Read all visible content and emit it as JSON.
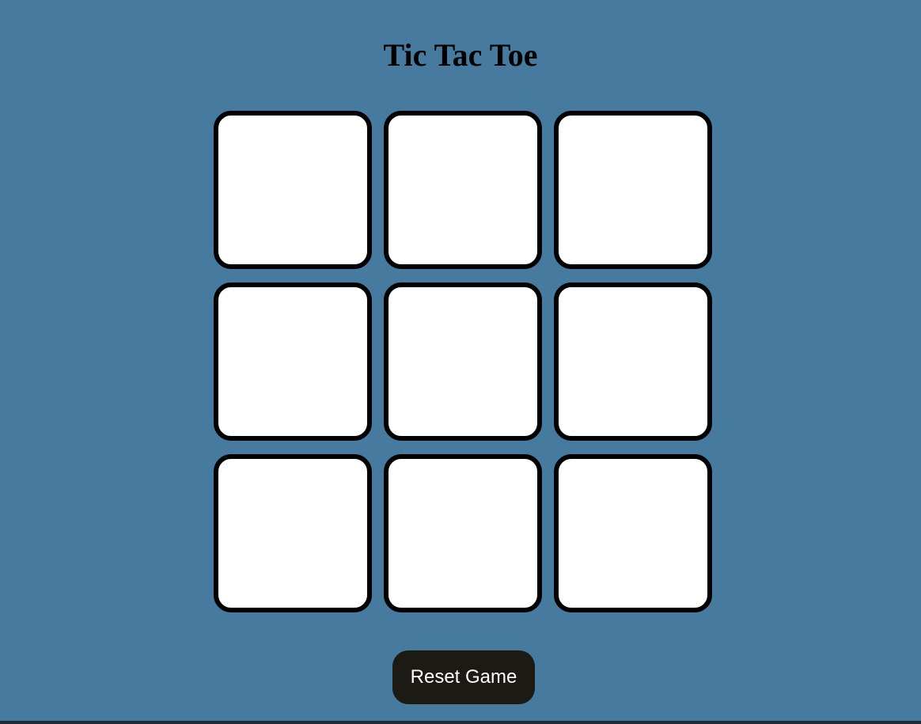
{
  "game": {
    "title": "Tic Tac Toe",
    "board": {
      "cells": [
        "",
        "",
        "",
        "",
        "",
        "",
        "",
        "",
        ""
      ]
    },
    "reset_label": "Reset Game"
  },
  "colors": {
    "background": "#467b9f",
    "cell_fill": "#ffffff",
    "cell_border": "#000000",
    "button_fill": "#1b1a15",
    "button_text": "#ffffff"
  }
}
